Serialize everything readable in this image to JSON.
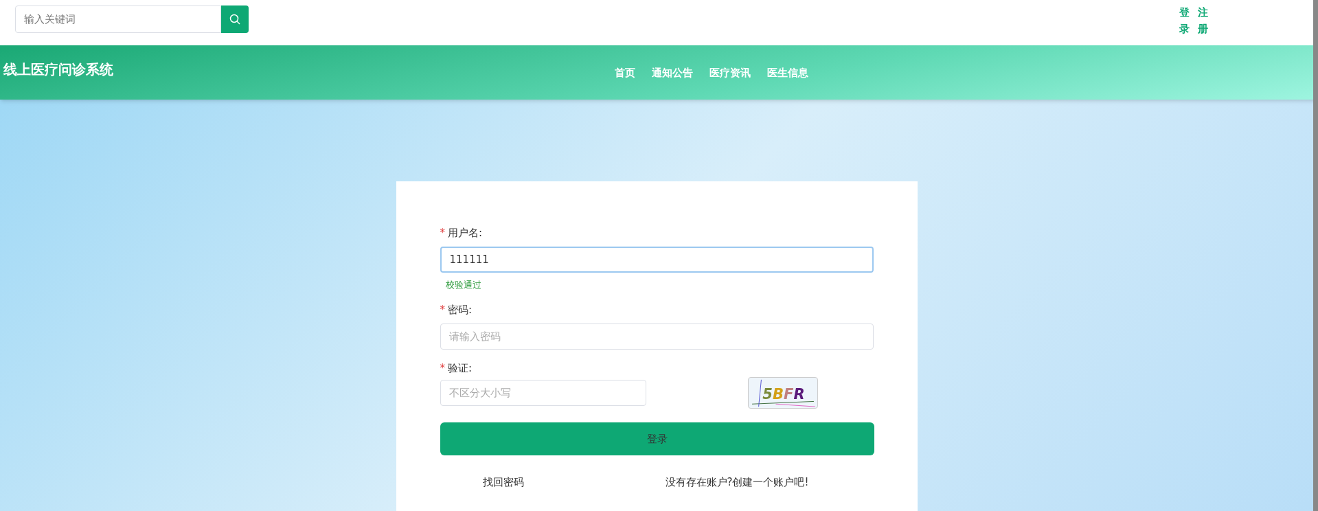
{
  "search": {
    "placeholder": "输入关键词"
  },
  "auth_links": [
    "登录",
    "注册"
  ],
  "header": {
    "title": "线上医疗问诊系统",
    "nav": [
      "首页",
      "通知公告",
      "医疗资讯",
      "医生信息"
    ]
  },
  "login_form": {
    "fields": [
      {
        "mark": "*",
        "label": "用户名:",
        "value": "111111",
        "focused": true,
        "hint": "校验通过"
      },
      {
        "mark": "*",
        "label": "密码:",
        "placeholder": "请输入密码",
        "focused": false
      },
      {
        "mark": "*",
        "label": "验证:",
        "placeholder": "不区分大小写",
        "focused": false,
        "captcha": "5BFR"
      }
    ],
    "submit": "登录",
    "links": [
      "找回密码",
      "没有存在账户?创建一个账户吧!"
    ]
  }
}
